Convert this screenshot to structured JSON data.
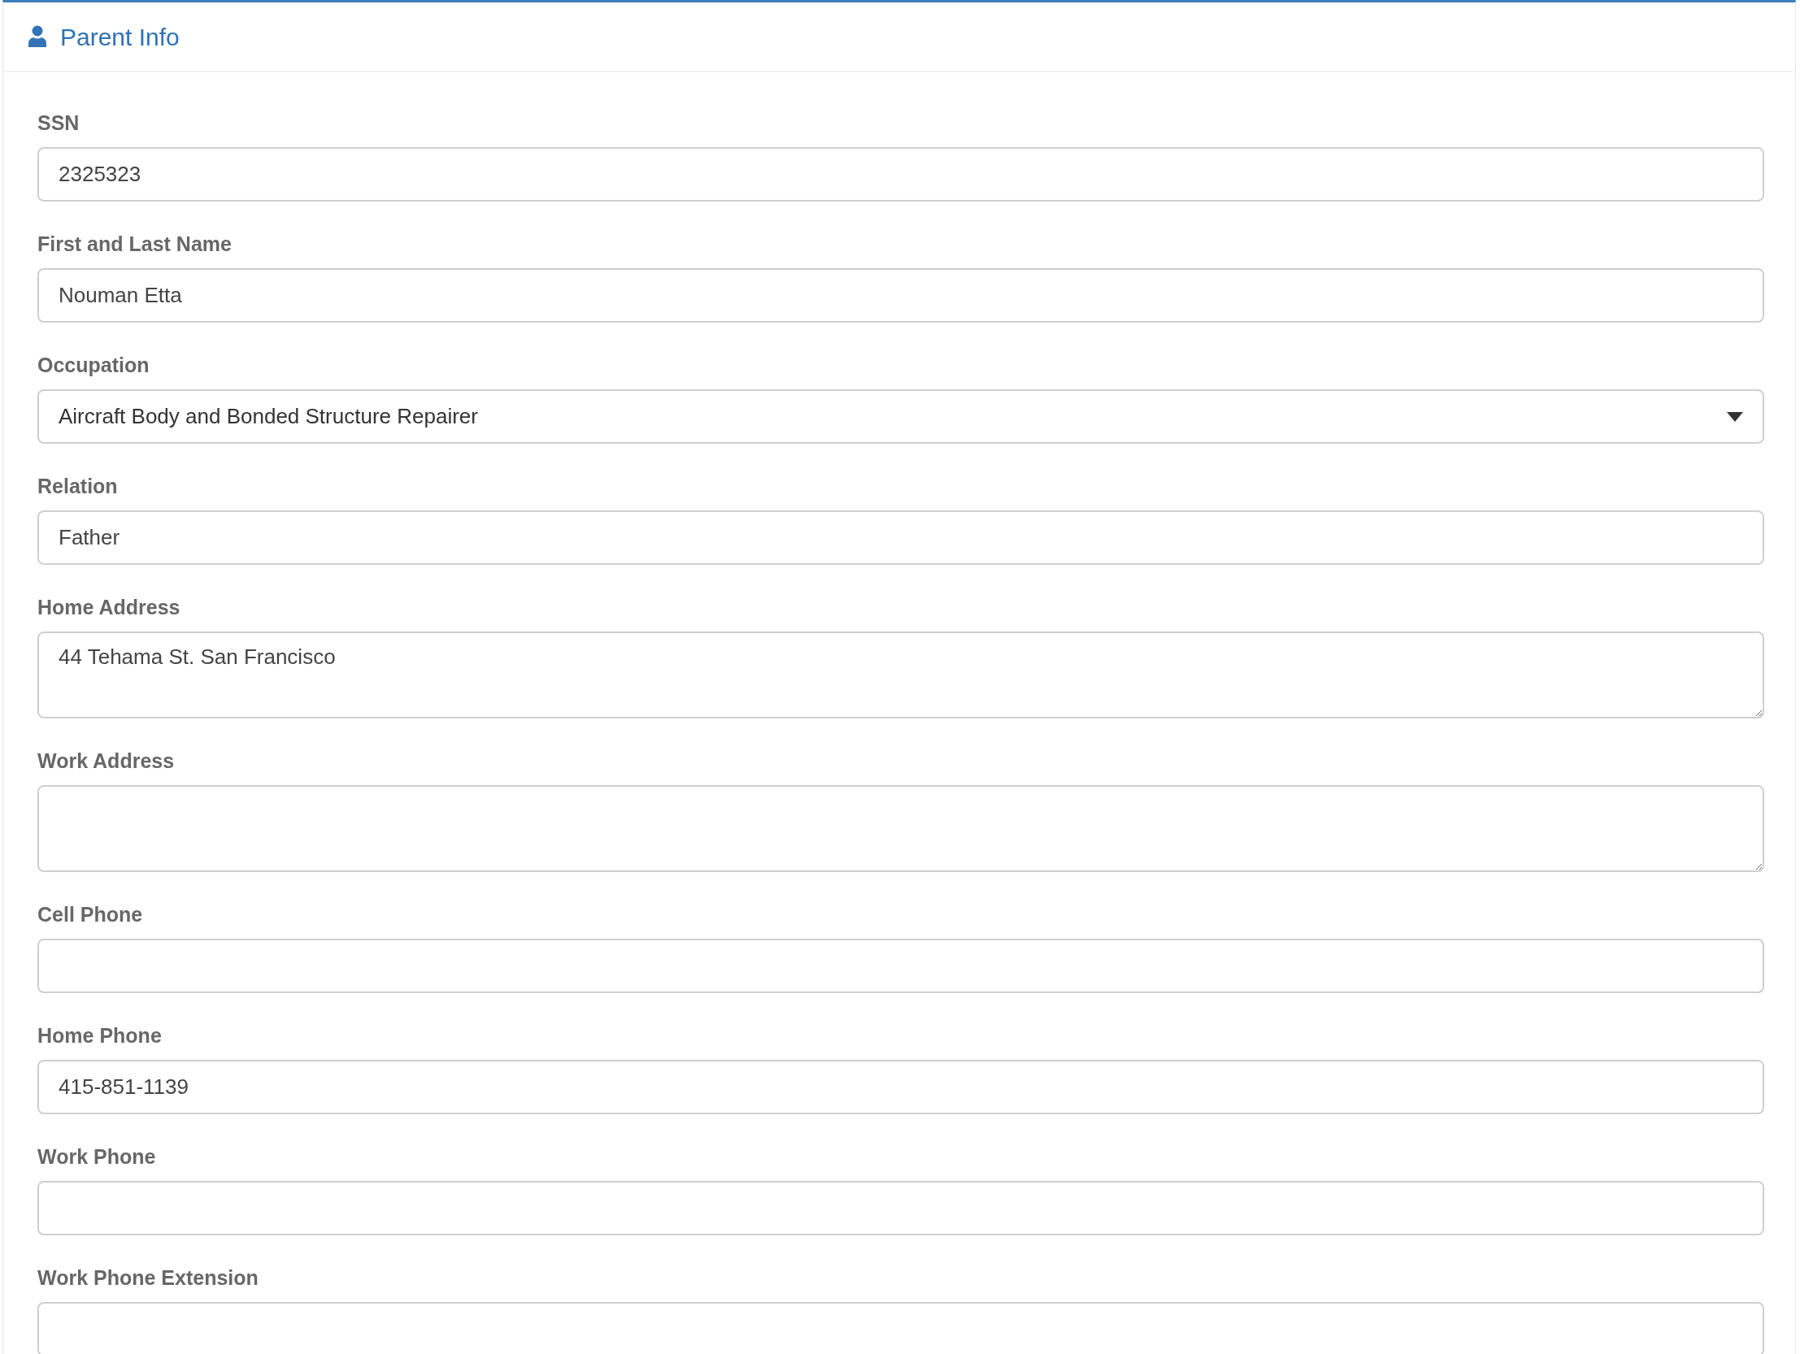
{
  "panel": {
    "title": "Parent Info"
  },
  "fields": [
    {
      "kind": "text",
      "label": "SSN",
      "value": "2325323"
    },
    {
      "kind": "text",
      "label": "First and Last Name",
      "value": "Nouman Etta"
    },
    {
      "kind": "select",
      "label": "Occupation",
      "value": "Aircraft Body and Bonded Structure Repairer"
    },
    {
      "kind": "text",
      "label": "Relation",
      "value": "Father"
    },
    {
      "kind": "textarea",
      "label": "Home Address",
      "value": "44 Tehama St. San Francisco"
    },
    {
      "kind": "textarea",
      "label": "Work Address"
    },
    {
      "kind": "text",
      "label": "Cell Phone"
    },
    {
      "kind": "text",
      "label": "Home Phone",
      "value": "415-851-1139"
    },
    {
      "kind": "text",
      "label": "Work Phone"
    },
    {
      "kind": "text",
      "label": "Work Phone Extension"
    }
  ]
}
